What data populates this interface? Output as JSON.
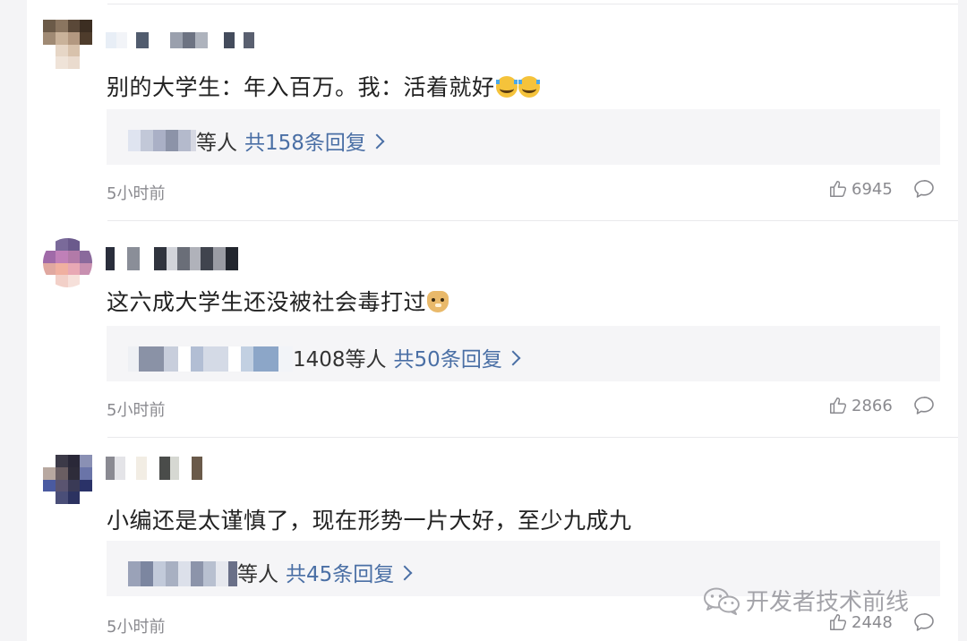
{
  "comments": [
    {
      "text": "别的大学生：年入百万。我：活着就好",
      "emoji": [
        "crying-laughing-emoji",
        "crying-laughing-emoji"
      ],
      "reply_summary": {
        "etc": "等人",
        "count": "共158条回复"
      },
      "time": "5小时前",
      "likes": "6945"
    },
    {
      "text": "这六成大学生还没被社会毒打过",
      "emoji": [
        "doge-emoji"
      ],
      "reply_summary": {
        "etc": "1408等人",
        "count": "共50条回复"
      },
      "time": "5小时前",
      "likes": "2866"
    },
    {
      "text": "小编还是太谨慎了，现在形势一片大好，至少九成九",
      "emoji": [],
      "reply_summary": {
        "etc": "等人",
        "count": "共45条回复"
      },
      "time": "5小时前",
      "likes": "2448"
    }
  ],
  "watermark": {
    "text": "开发者技术前线",
    "icon": "wechat-icon"
  },
  "colors": {
    "link": "#4a6fa5",
    "meta": "#8a8a8f",
    "reply_bg": "#f5f5f7"
  }
}
